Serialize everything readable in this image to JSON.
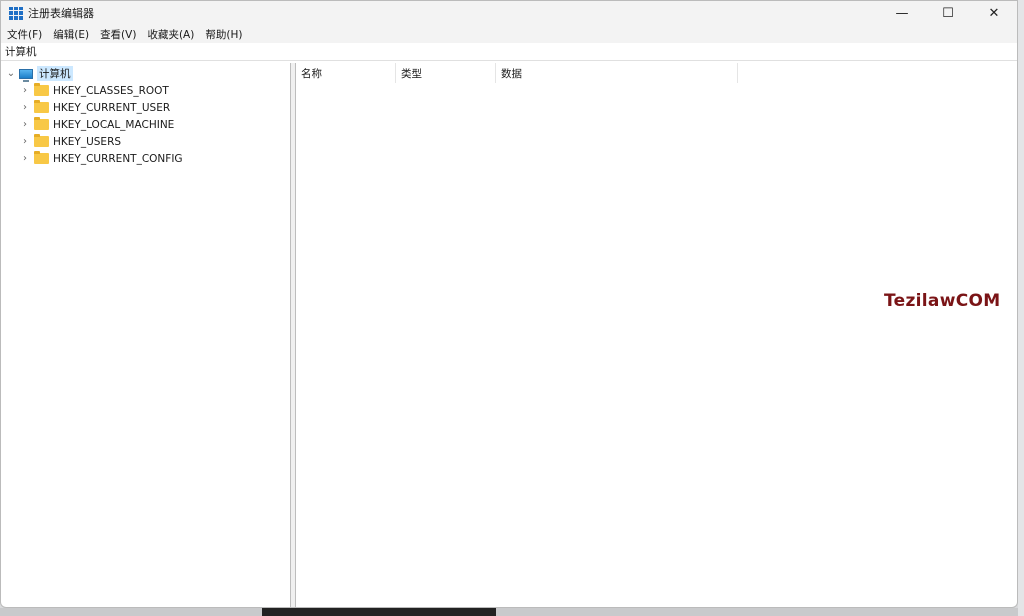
{
  "window": {
    "title": "注册表编辑器",
    "minimize": "—",
    "maximize": "☐",
    "close": "✕"
  },
  "menu": [
    "文件(F)",
    "编辑(E)",
    "查看(V)",
    "收藏夹(A)",
    "帮助(H)"
  ],
  "address": "计算机",
  "tree": {
    "root": "计算机",
    "children": [
      "HKEY_CLASSES_ROOT",
      "HKEY_CURRENT_USER",
      "HKEY_LOCAL_MACHINE",
      "HKEY_USERS",
      "HKEY_CURRENT_CONFIG"
    ]
  },
  "columns": [
    "名称",
    "类型",
    "数据"
  ],
  "watermark": "TezilawCOM"
}
